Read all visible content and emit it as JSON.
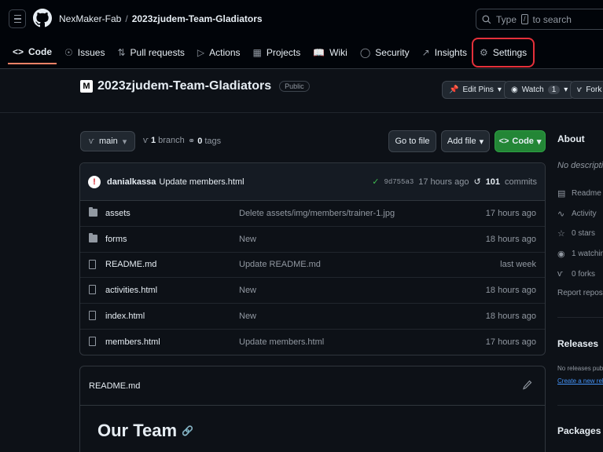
{
  "header": {
    "owner": "NexMaker-Fab",
    "separator": "/",
    "repo": "2023zjudem-Team-Gladiators",
    "search_prefix": "Type",
    "search_key": "/",
    "search_suffix": "to search"
  },
  "tabs": [
    {
      "label": "Code",
      "icon": "code-icon"
    },
    {
      "label": "Issues",
      "icon": "issue-icon"
    },
    {
      "label": "Pull requests",
      "icon": "pull-request-icon"
    },
    {
      "label": "Actions",
      "icon": "play-icon"
    },
    {
      "label": "Projects",
      "icon": "table-icon"
    },
    {
      "label": "Wiki",
      "icon": "book-icon"
    },
    {
      "label": "Security",
      "icon": "shield-icon"
    },
    {
      "label": "Insights",
      "icon": "graph-icon"
    },
    {
      "label": "Settings",
      "icon": "gear-icon"
    }
  ],
  "repo_header": {
    "avatar_letter": "M",
    "name": "2023zjudem-Team-Gladiators",
    "visibility": "Public",
    "edit_pins": "Edit Pins",
    "watch": "Watch",
    "watch_count": "1",
    "fork": "Fork"
  },
  "branch_bar": {
    "branch": "main",
    "branch_count": "1",
    "branch_word": "branch",
    "tag_count": "0",
    "tag_word": "tags",
    "go_to_file": "Go to file",
    "add_file": "Add file",
    "code": "Code"
  },
  "latest_commit": {
    "author": "danialkassa",
    "message": "Update members.html",
    "sha": "9d755a3",
    "time": "17 hours ago",
    "commit_count": "101",
    "commit_word": "commits"
  },
  "files": [
    {
      "name": "assets",
      "type": "dir",
      "commit": "Delete assets/img/members/trainer-1.jpg",
      "time": "17 hours ago"
    },
    {
      "name": "forms",
      "type": "dir",
      "commit": "New",
      "time": "18 hours ago"
    },
    {
      "name": "README.md",
      "type": "file",
      "commit": "Update README.md",
      "time": "last week"
    },
    {
      "name": "activities.html",
      "type": "file",
      "commit": "New",
      "time": "18 hours ago"
    },
    {
      "name": "index.html",
      "type": "file",
      "commit": "New",
      "time": "18 hours ago"
    },
    {
      "name": "members.html",
      "type": "file",
      "commit": "Update members.html",
      "time": "17 hours ago"
    }
  ],
  "readme": {
    "filename": "README.md",
    "heading": "Our Team"
  },
  "about": {
    "title": "About",
    "description": "No descriptio",
    "readme": "Readme",
    "activity": "Activity",
    "stars": "0 stars",
    "watching": "1 watchin",
    "forks": "0 forks",
    "report": "Report reposit",
    "releases_title": "Releases",
    "no_releases": "No releases pub",
    "create_release": "Create a new rel",
    "packages_title": "Packages"
  },
  "colors": {
    "background": "#0d1117",
    "header": "#010409",
    "accent_green": "#238636",
    "selected_tab_underline": "#f78166",
    "highlight_box": "#e5303a"
  }
}
